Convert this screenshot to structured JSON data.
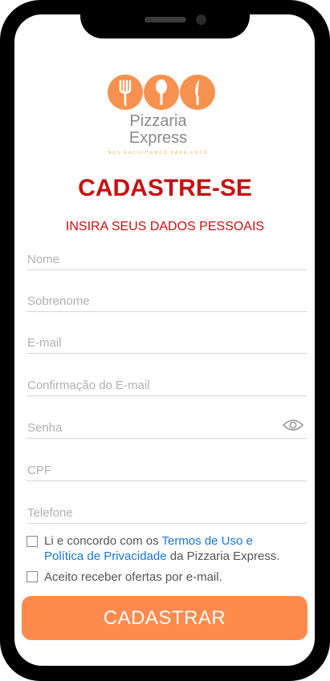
{
  "brand": {
    "name_line1": "Pizzaria",
    "name_line2": "Express",
    "tagline": "NOS FACILITAMOS PARA VOCÊ",
    "accent_color": "#f7914f"
  },
  "header": {
    "title": "CADASTRE-SE",
    "subtitle": "INSIRA SEUS DADOS PESSOAIS"
  },
  "form": {
    "fields": [
      {
        "placeholder": "Nome"
      },
      {
        "placeholder": "Sobrenome"
      },
      {
        "placeholder": "E-mail"
      },
      {
        "placeholder": "Confirmação do E-mail"
      },
      {
        "placeholder": "Senha",
        "icon": "eye-icon"
      },
      {
        "placeholder": "CPF"
      },
      {
        "placeholder": "Telefone"
      }
    ],
    "terms": {
      "prefix": "Li e concordo com os ",
      "link1": "Termos de Uso e",
      "link2": "Política de Privacidade",
      "suffix": " da Pizzaria Express."
    },
    "offers": "Aceito receber ofertas por e-mail.",
    "submit_label": "CADASTRAR"
  }
}
